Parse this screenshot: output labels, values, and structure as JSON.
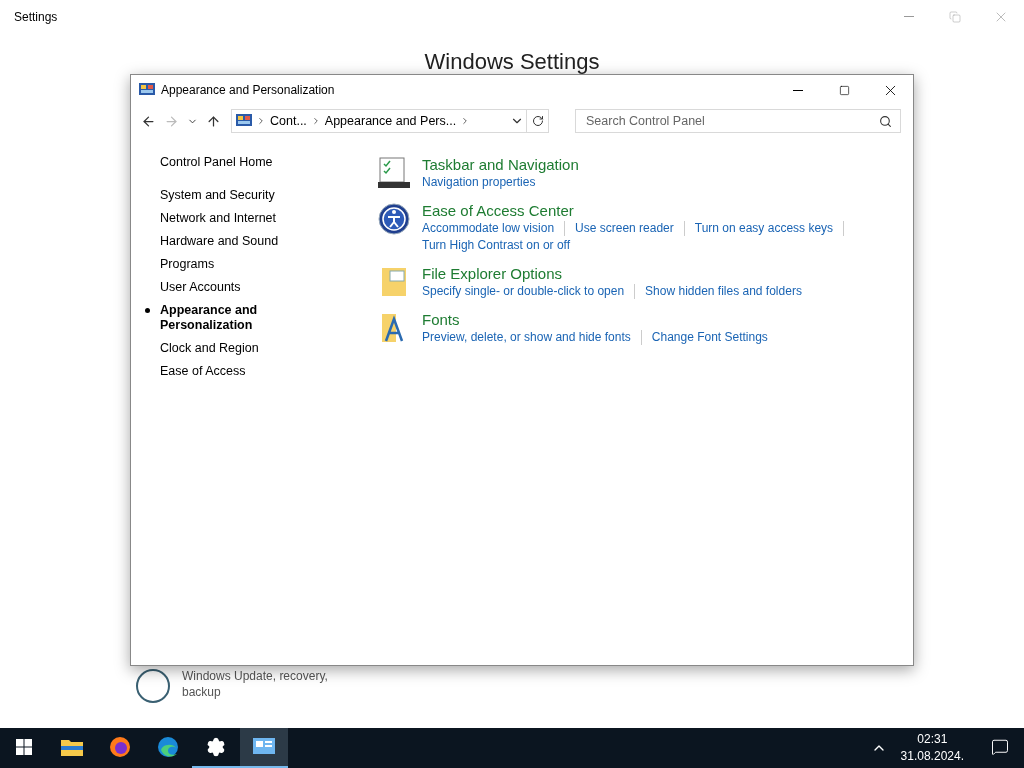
{
  "settings_window": {
    "title": "Settings",
    "heading": "Windows Settings",
    "partial_item": {
      "description": "Windows Update, recovery, backup"
    }
  },
  "dialog": {
    "title": "Appearance and Personalization",
    "breadcrumb": [
      "Cont...",
      "Appearance and Pers..."
    ],
    "search": {
      "placeholder": "Search Control Panel"
    }
  },
  "sidebar": {
    "home": "Control Panel Home",
    "items": [
      {
        "label": "System and Security",
        "selected": false
      },
      {
        "label": "Network and Internet",
        "selected": false
      },
      {
        "label": "Hardware and Sound",
        "selected": false
      },
      {
        "label": "Programs",
        "selected": false
      },
      {
        "label": "User Accounts",
        "selected": false
      },
      {
        "label": "Appearance and Personalization",
        "selected": true
      },
      {
        "label": "Clock and Region",
        "selected": false
      },
      {
        "label": "Ease of Access",
        "selected": false
      }
    ]
  },
  "categories": [
    {
      "kind": "taskbar",
      "title": "Taskbar and Navigation",
      "links": [
        "Navigation properties"
      ]
    },
    {
      "kind": "ease",
      "title": "Ease of Access Center",
      "links": [
        "Accommodate low vision",
        "Use screen reader",
        "Turn on easy access keys",
        "Turn High Contrast on or off"
      ]
    },
    {
      "kind": "explorer",
      "title": "File Explorer Options",
      "links": [
        "Specify single- or double-click to open",
        "Show hidden files and folders"
      ]
    },
    {
      "kind": "fonts",
      "title": "Fonts",
      "links": [
        "Preview, delete, or show and hide fonts",
        "Change Font Settings"
      ]
    }
  ],
  "taskbar": {
    "apps": [
      {
        "kind": "explorer",
        "running": false,
        "selected": false
      },
      {
        "kind": "firefox",
        "running": false,
        "selected": false
      },
      {
        "kind": "edge",
        "running": false,
        "selected": false
      },
      {
        "kind": "settings",
        "running": true,
        "selected": false
      },
      {
        "kind": "control",
        "running": true,
        "selected": true
      }
    ],
    "time": "02:31",
    "date": "31.08.2024."
  }
}
